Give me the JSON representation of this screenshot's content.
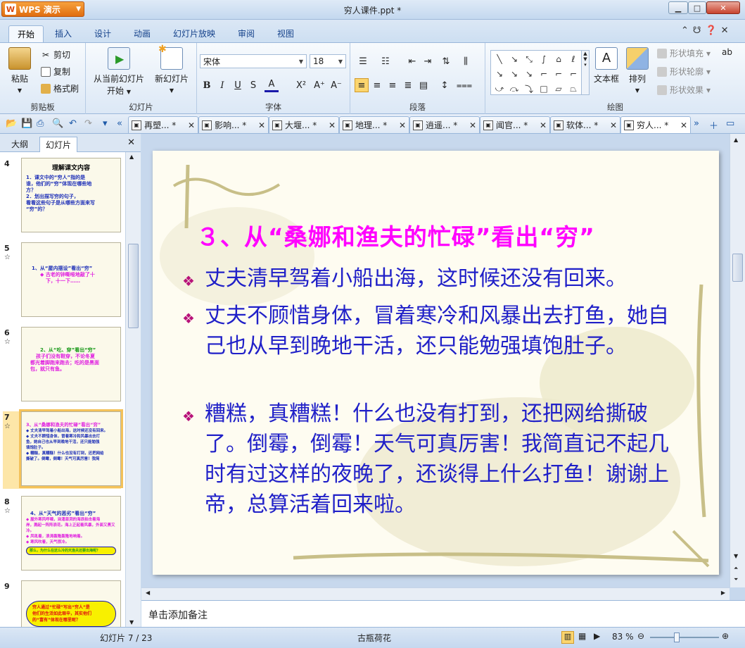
{
  "app": {
    "name": "WPS 演示",
    "window_title": "穷人课件.ppt *"
  },
  "ribbon_tabs": [
    "开始",
    "插入",
    "设计",
    "动画",
    "幻灯片放映",
    "审阅",
    "视图"
  ],
  "clipboard": {
    "paste": "粘贴",
    "cut": "剪切",
    "copy": "复制",
    "format_painter": "格式刷",
    "label": "剪贴板"
  },
  "slides_group": {
    "from_current": "从当前幻灯片",
    "start": "开始",
    "new_slide": "新幻灯片",
    "label": "幻灯片"
  },
  "font": {
    "name": "宋体",
    "size": "18",
    "label": "字体",
    "bold": "B",
    "italic": "I",
    "underline": "U",
    "shadow": "S"
  },
  "paragraph": {
    "label": "段落"
  },
  "drawing": {
    "textbox": "文本框",
    "arrange": "排列",
    "shape_fill": "形状填充",
    "shape_outline": "形状轮廓",
    "shape_effect": "形状效果",
    "label": "绘图"
  },
  "doc_tabs": [
    {
      "label": "再塑... *"
    },
    {
      "label": "影响... *"
    },
    {
      "label": "大堰... *"
    },
    {
      "label": "地理... *"
    },
    {
      "label": "逍遥... *"
    },
    {
      "label": "闻官... *"
    },
    {
      "label": "软体... *"
    },
    {
      "label": "穷人... *"
    }
  ],
  "left_pane": {
    "tab_outline": "大纲",
    "tab_slides": "幻灯片"
  },
  "thumbnails": [
    {
      "num": "4",
      "lines": [
        "理解课文内容",
        "1．课文中的“穷人”指的是",
        "谁，他们的“穷”体现在哪些地",
        "方？",
        "2．划出描写穷的句子，",
        "看看这些句子是从哪些方面来写",
        "“穷”的？"
      ]
    },
    {
      "num": "5",
      "lines": [
        "1、从“屋内摆设”看出“穷”",
        "",
        "◆ 古老的钟嘶哑地敲了十",
        "下，十一下……"
      ]
    },
    {
      "num": "6",
      "lines": [
        "2、从“吃、穿”看出“穷”",
        "",
        "孩子们没有鞋穿，不论冬夏",
        "都光着脚跑来跑去；吃的是黑面",
        "包，就只有鱼。"
      ]
    },
    {
      "num": "7",
      "lines": [
        "3、从“桑娜和渔夫的忙碌”看出“穷”",
        "◆ 丈夫清早驾着小船出海，这时候还没有回来。",
        "◆ 丈夫不顾惜身体，冒着寒冷和风暴出去打",
        "鱼，她自己也从早到晚地干活，还只能勉强",
        "填饱肚子。",
        "◆ 糟糕，真糟糕！什么也没有打到，还把网给",
        "撕破了。倒霉，倒霉！天气可真厉害！我简"
      ]
    },
    {
      "num": "8",
      "lines": [
        "4、从“天气的恶劣”看出“穷”",
        "◆ 屋外寒风呼啸，汹涌澎湃的海浪拍击着海",
        "岸，溅起一阵阵浪花。海上正起着风暴，外面又黑又",
        "冷。",
        "◆ 风吼着，浪涛轰隆轰隆地响着。",
        "◆ 寒风吹着，天气很冷。",
        "",
        "那么，为什么在这么冷的天渔夫还要出海呢？"
      ]
    },
    {
      "num": "9",
      "lines": [
        "穷人通过“忙碌”写出“穷人”是",
        "他们的生活如此艰辛，其实他们",
        "的“富有”体现在哪里呢？"
      ]
    }
  ],
  "slide": {
    "title": "３、从“桑娜和渔夫的忙碌”看出“穷”",
    "bullets": [
      "丈夫清早驾着小船出海，这时候还没有回来。",
      "丈夫不顾惜身体，冒着寒冷和风暴出去打鱼，她自己也从早到晚地干活，还只能勉强填饱肚子。",
      "糟糕，真糟糕！什么也没有打到，还把网给撕破了。倒霉，倒霉！天气可真厉害！我简直记不起几时有过这样的夜晚了，还谈得上什么打鱼！谢谢上帝，总算活着回来啦。"
    ]
  },
  "notes_placeholder": "单击添加备注",
  "status": {
    "slide_info": "幻灯片 7 / 23",
    "theme": "古瓶荷花",
    "zoom": "83 %"
  },
  "colors": {
    "title": "#ff00ff",
    "body": "#2020c8",
    "bullet": "#b8127a",
    "accent": "#e06d10"
  }
}
